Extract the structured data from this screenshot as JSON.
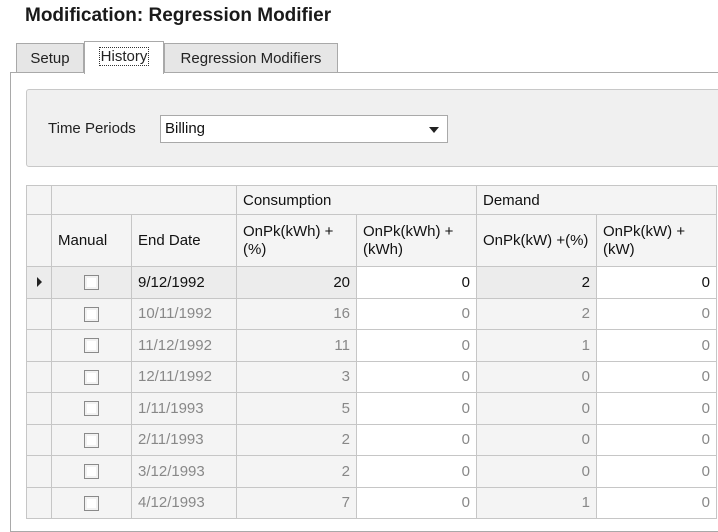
{
  "title": "Modification: Regression Modifier",
  "tabs": [
    {
      "label": "Setup"
    },
    {
      "label": "History"
    },
    {
      "label": "Regression Modifiers"
    }
  ],
  "filter": {
    "label": "Time Periods",
    "value": "Billing"
  },
  "grid": {
    "bands": {
      "consumption": "Consumption",
      "demand": "Demand"
    },
    "columns": [
      "Manual",
      "End Date",
      "OnPk(kWh) +(%)",
      "OnPk(kWh) +(kWh)",
      "OnPk(kW) +(%)",
      "OnPk(kW) +(kW)"
    ],
    "rows": [
      {
        "manual": false,
        "end_date": "9/12/1992",
        "c1": "20",
        "c2": "0",
        "d1": "2",
        "d2": "0"
      },
      {
        "manual": false,
        "end_date": "10/11/1992",
        "c1": "16",
        "c2": "0",
        "d1": "2",
        "d2": "0"
      },
      {
        "manual": false,
        "end_date": "11/12/1992",
        "c1": "11",
        "c2": "0",
        "d1": "1",
        "d2": "0"
      },
      {
        "manual": false,
        "end_date": "12/11/1992",
        "c1": "3",
        "c2": "0",
        "d1": "0",
        "d2": "0"
      },
      {
        "manual": false,
        "end_date": "1/11/1993",
        "c1": "5",
        "c2": "0",
        "d1": "0",
        "d2": "0"
      },
      {
        "manual": false,
        "end_date": "2/11/1993",
        "c1": "2",
        "c2": "0",
        "d1": "0",
        "d2": "0"
      },
      {
        "manual": false,
        "end_date": "3/12/1993",
        "c1": "2",
        "c2": "0",
        "d1": "0",
        "d2": "0"
      },
      {
        "manual": false,
        "end_date": "4/12/1993",
        "c1": "7",
        "c2": "0",
        "d1": "1",
        "d2": "0"
      }
    ]
  }
}
